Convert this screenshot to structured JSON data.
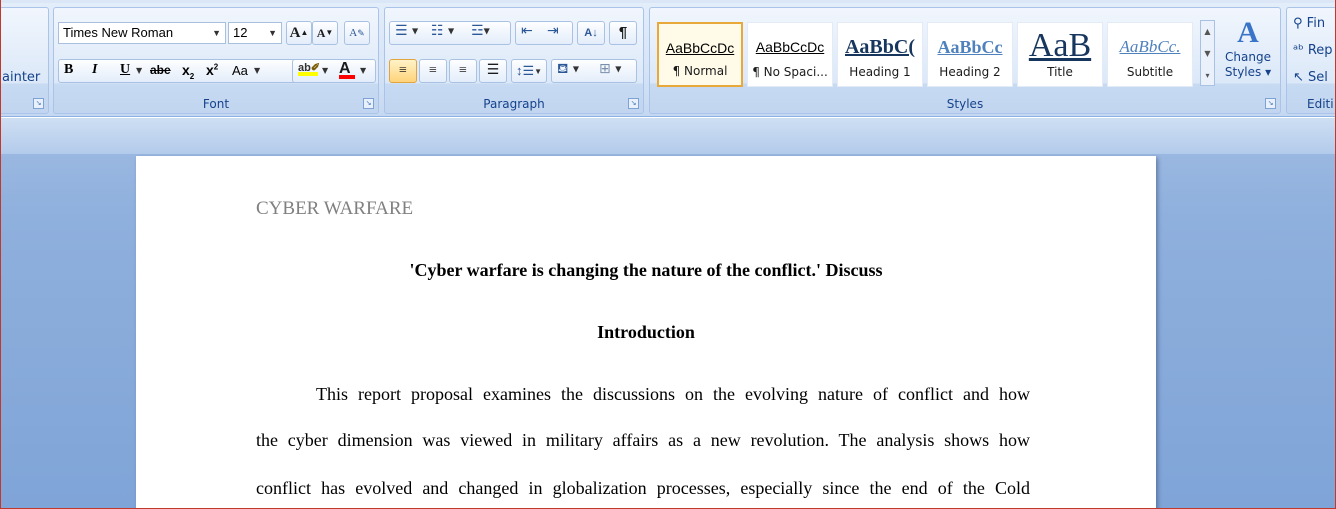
{
  "ribbon": {
    "clipboard": {
      "format_painter_label": "ainter"
    },
    "font": {
      "group_label": "Font",
      "font_name": "Times New Roman",
      "font_size": "12",
      "grow_font": "A",
      "shrink_font": "A",
      "clear_format": "A",
      "bold": "B",
      "italic": "I",
      "underline": "U",
      "strikethrough": "abe",
      "subscript": "x",
      "superscript": "x",
      "change_case": "Aa",
      "highlight": "ab",
      "font_color": "A"
    },
    "paragraph": {
      "group_label": "Paragraph",
      "sort_label": "A↓",
      "show_marks": "¶"
    },
    "styles": {
      "group_label": "Styles",
      "tiles": [
        {
          "sample": "AaBbCcDc",
          "name": "¶ Normal"
        },
        {
          "sample": "AaBbCcDc",
          "name": "¶ No Spaci..."
        },
        {
          "sample": "AaBbC(",
          "name": "Heading 1"
        },
        {
          "sample": "AaBbCc",
          "name": "Heading 2"
        },
        {
          "sample": "AaB",
          "name": "Title"
        },
        {
          "sample": "AaBbCc.",
          "name": "Subtitle"
        }
      ],
      "change_styles_line1": "Change",
      "change_styles_line2": "Styles ▾"
    },
    "editing": {
      "group_label": "Editi",
      "find": "Fin",
      "replace": "Rep",
      "select": "Sel"
    }
  },
  "document": {
    "header": "CYBER WARFARE",
    "title": "'Cyber warfare is changing the nature of the conflict.' Discuss",
    "intro_heading": "Introduction",
    "lines": [
      "This report proposal examines the discussions on the evolving nature of conflict and how",
      "the cyber dimension was viewed in military affairs as a new revolution. The analysis shows how",
      "conflict has evolved and changed in globalization processes, especially since the end of the Cold"
    ]
  },
  "colors": {
    "ribbon_text": "#15428b",
    "selected_style": "#e9a93a",
    "heading_blue": "#17365d",
    "font_color_bar": "#ff0000",
    "highlight_bar": "#ffff00"
  }
}
